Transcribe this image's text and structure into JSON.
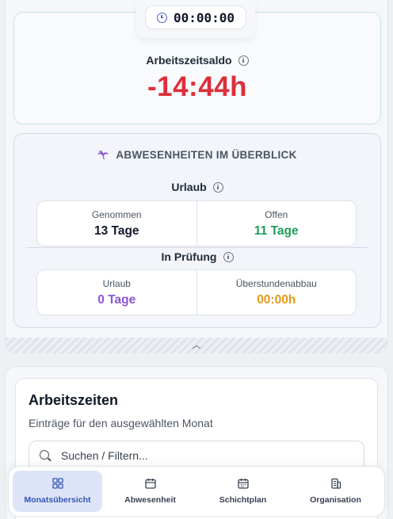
{
  "timer": {
    "value": "00:00:00",
    "icon": "clock-icon"
  },
  "balance": {
    "title": "Arbeitszeitsaldo",
    "value": "-14:44h",
    "value_color": "#dc2f3b"
  },
  "absences": {
    "header": "ABWESENHEITEN IM ÜBERBLICK",
    "vacation": {
      "label": "Urlaub",
      "taken_label": "Genommen",
      "taken_value": "13 Tage",
      "open_label": "Offen",
      "open_value": "11 Tage"
    },
    "in_review": {
      "label": "In Prüfung",
      "vacation_label": "Urlaub",
      "vacation_value": "0 Tage",
      "overtime_label": "Überstundenabbau",
      "overtime_value": "00:00h"
    }
  },
  "work_times": {
    "title": "Arbeitszeiten",
    "subtitle": "Einträge für den ausgewählten Monat",
    "search_placeholder": "Suchen / Filtern..."
  },
  "nav": {
    "items": [
      {
        "label": "Monatsübersicht",
        "icon": "grid-icon",
        "active": true
      },
      {
        "label": "Abwesenheit",
        "icon": "calendar-icon",
        "active": false
      },
      {
        "label": "Schichtplan",
        "icon": "calendar-grid-icon",
        "active": false
      },
      {
        "label": "Organisation",
        "icon": "building-icon",
        "active": false
      }
    ]
  },
  "colors": {
    "accent": "#3454b4",
    "negative": "#dc2f3b",
    "positive": "#1e9d57",
    "purple": "#8b55d6",
    "orange": "#e59a1a"
  }
}
